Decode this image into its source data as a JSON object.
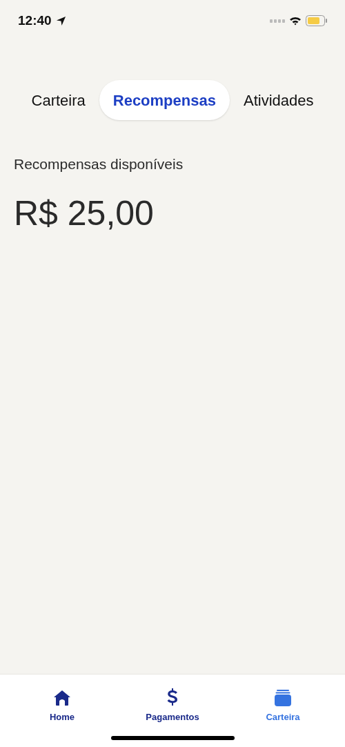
{
  "status_bar": {
    "time": "12:40"
  },
  "tabs": [
    {
      "label": "Carteira",
      "selected": false
    },
    {
      "label": "Recompensas",
      "selected": true
    },
    {
      "label": "Atividades",
      "selected": false
    }
  ],
  "rewards": {
    "label": "Recompensas disponíveis",
    "amount": "R$ 25,00"
  },
  "bottom_nav": [
    {
      "kind": "home",
      "label": "Home",
      "selected": false
    },
    {
      "kind": "payments",
      "label": "Pagamentos",
      "selected": false
    },
    {
      "kind": "wallet",
      "label": "Carteira",
      "selected": true
    }
  ]
}
